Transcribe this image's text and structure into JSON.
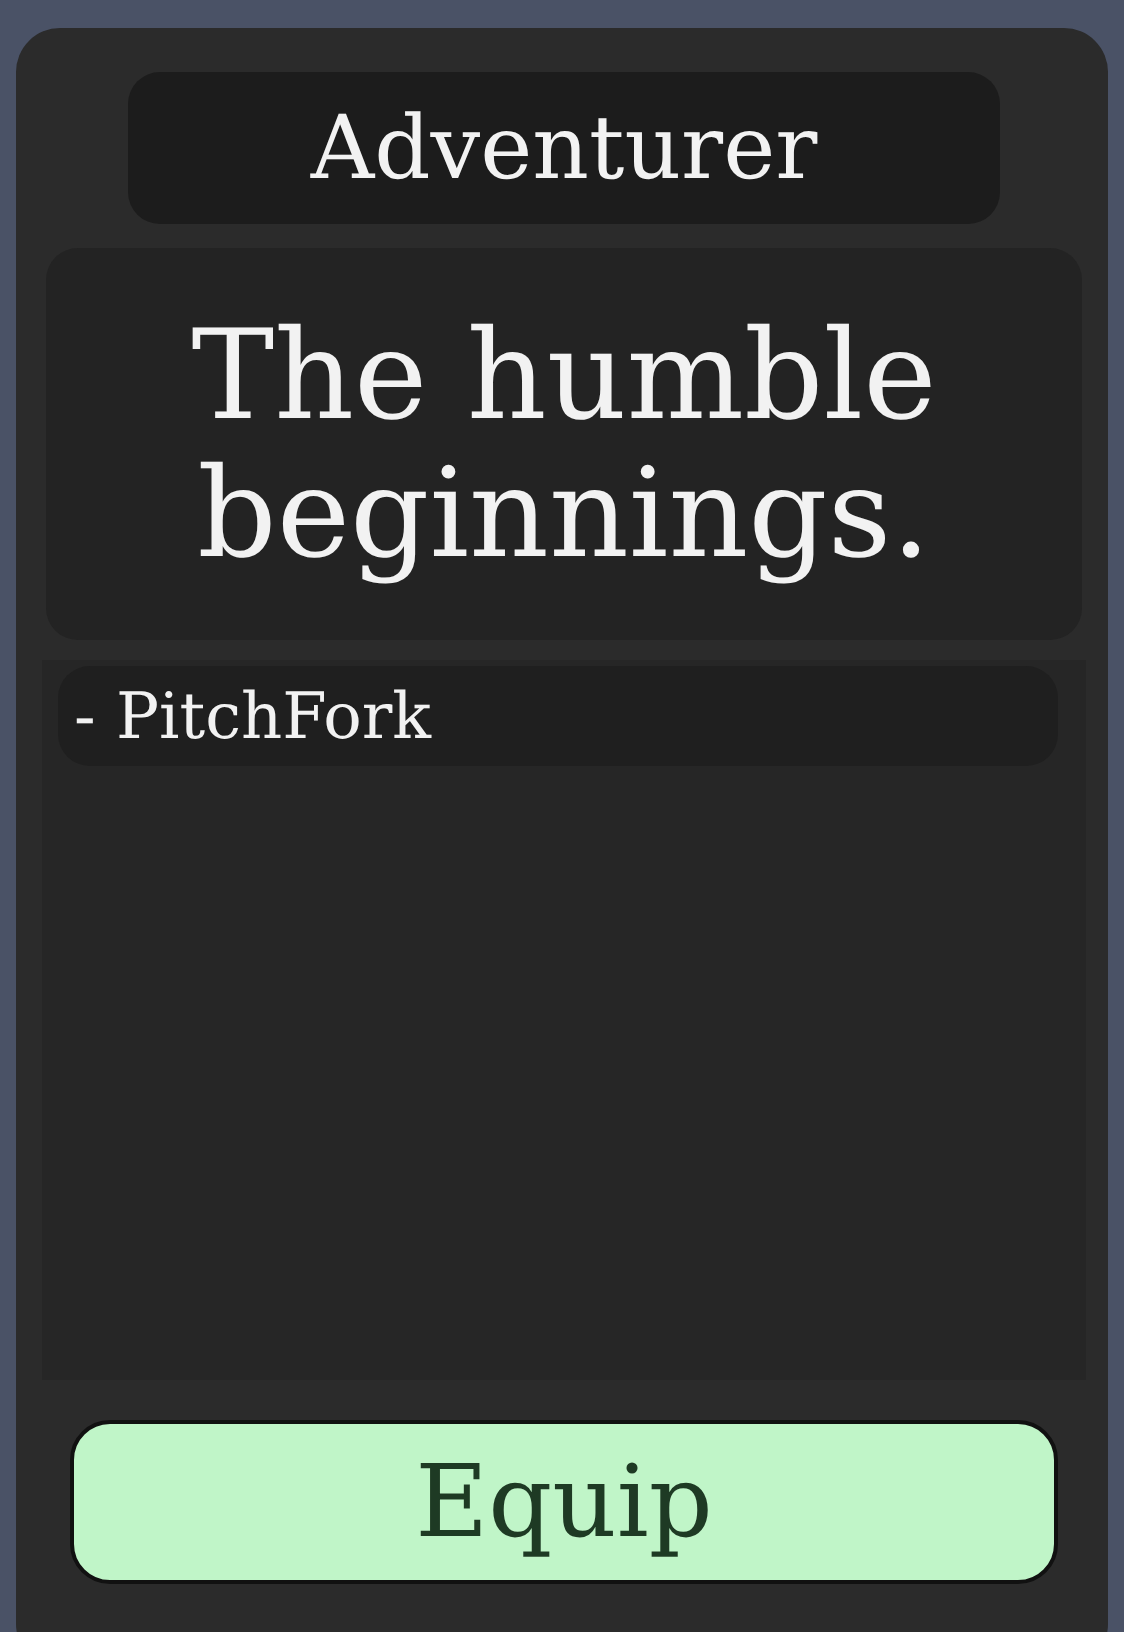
{
  "title": "Adventurer",
  "quote": "The humble beginnings.",
  "author": "- PitchFork",
  "button": {
    "label": "Equip"
  }
}
